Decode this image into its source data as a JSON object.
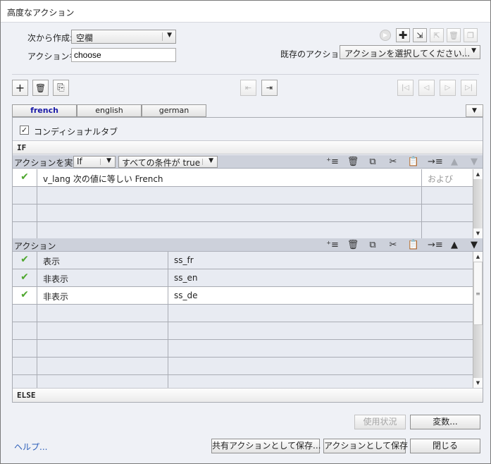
{
  "window": {
    "title": "高度なアクション"
  },
  "form": {
    "create_from_label": "次から作成:",
    "create_from_value": "空欄",
    "action_name_label": "アクション名:",
    "action_name_value": "choose",
    "existing_actions_label": "既存のアクション:",
    "existing_actions_value": "アクションを選択してください..."
  },
  "top_toolbar": {
    "icons": [
      "play-icon",
      "add-icon",
      "import-icon",
      "export-icon",
      "trash-icon",
      "duplicate-icon"
    ]
  },
  "tab_toolbar": {
    "add": "+",
    "delete": "🗑",
    "copy": "⎘"
  },
  "tabs": [
    {
      "label": "french",
      "active": true
    },
    {
      "label": "english",
      "active": false
    },
    {
      "label": "german",
      "active": false
    }
  ],
  "conditional_tab": {
    "label": "コンディショナルタブ",
    "checked": true
  },
  "if_section": {
    "label": "IF",
    "perform_label": "アクションを実行:",
    "perform_value": "If",
    "condition_value": "すべての条件が true",
    "rows": [
      {
        "checked": true,
        "text": "v_lang   次の値に等しい   French",
        "operator": "および"
      },
      {
        "checked": false,
        "text": "",
        "operator": ""
      },
      {
        "checked": false,
        "text": "",
        "operator": ""
      },
      {
        "checked": false,
        "text": "",
        "operator": ""
      }
    ]
  },
  "actions_section": {
    "label": "アクション",
    "rows": [
      {
        "checked": true,
        "action": "表示",
        "target": "ss_fr"
      },
      {
        "checked": true,
        "action": "非表示",
        "target": "ss_en"
      },
      {
        "checked": true,
        "action": "非表示",
        "target": "ss_de"
      },
      {
        "checked": false,
        "action": "",
        "target": ""
      },
      {
        "checked": false,
        "action": "",
        "target": ""
      },
      {
        "checked": false,
        "action": "",
        "target": ""
      },
      {
        "checked": false,
        "action": "",
        "target": ""
      },
      {
        "checked": false,
        "action": "",
        "target": ""
      }
    ]
  },
  "else_section": {
    "label": "ELSE"
  },
  "buttons": {
    "usage": "使用状況",
    "variables": "変数...",
    "save_shared": "共有アクションとして保存...",
    "save_action": "アクションとして保存",
    "close": "閉じる"
  },
  "help_link": "ヘルプ..."
}
